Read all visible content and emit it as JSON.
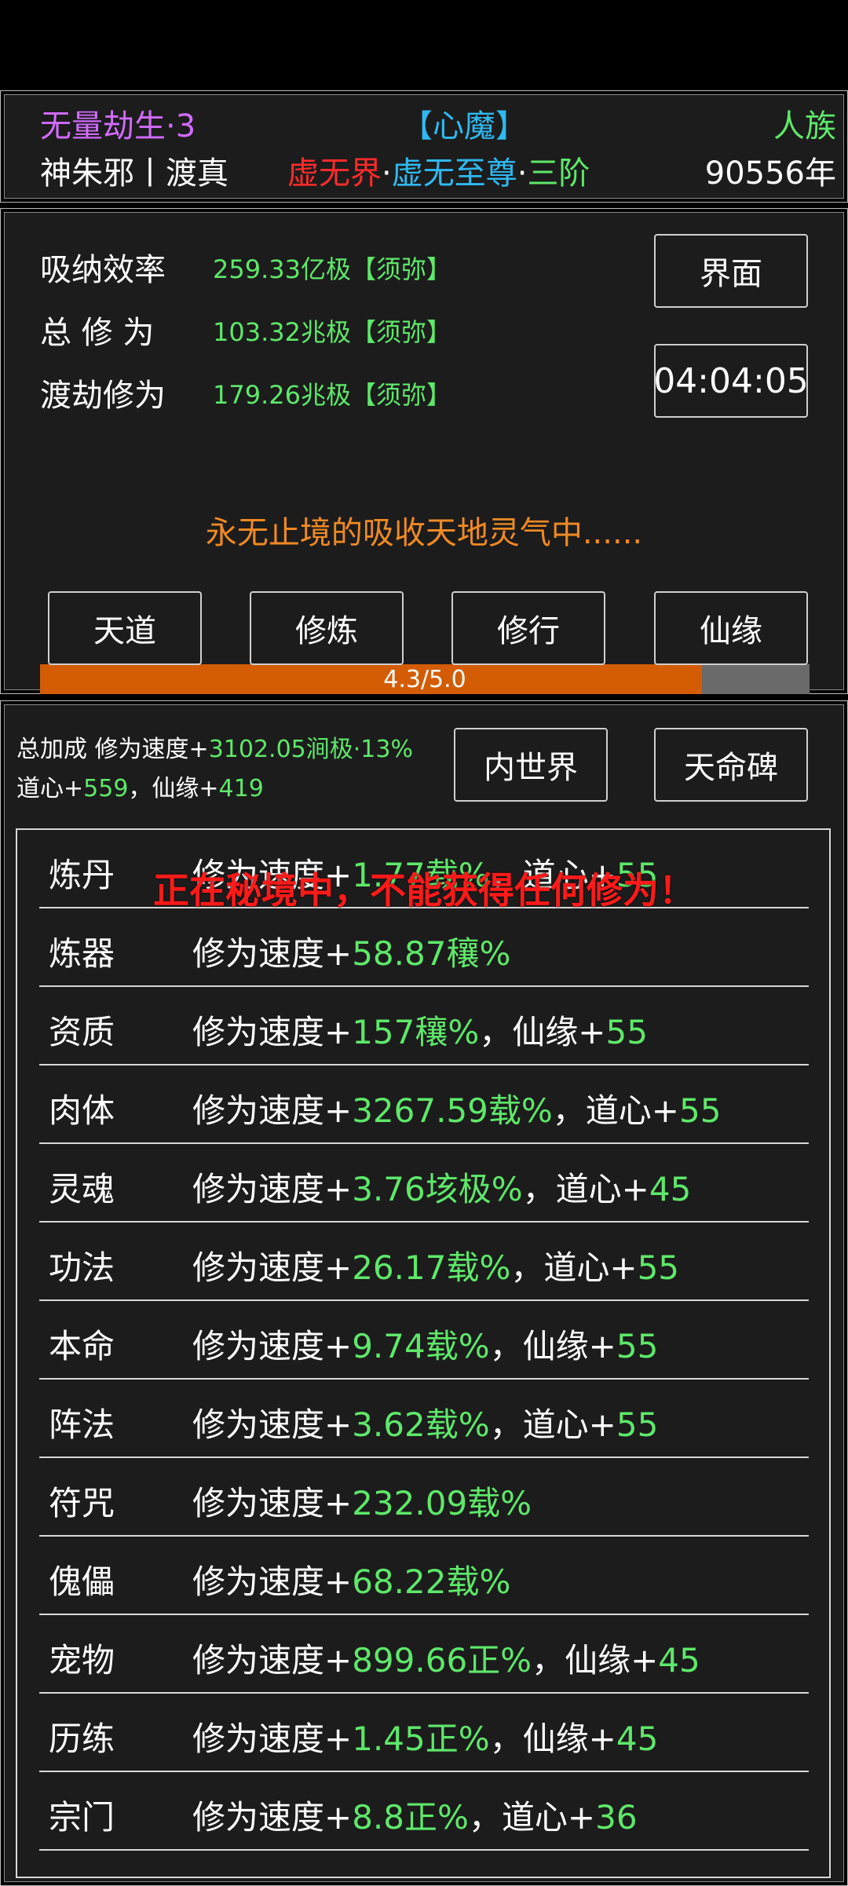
{
  "header": {
    "realm_title": "无量劫生·3",
    "status": "【心魔】",
    "race": "人族",
    "name": "神朱邪丨渡真",
    "world_a": "虚无界",
    "dot": "·",
    "world_b": "虚无至尊",
    "world_c": "三阶",
    "years": "90556年"
  },
  "stats": {
    "absorb_label": "吸纳效率",
    "absorb_value": "259.33亿极【须弥】",
    "total_label": "总 修 为",
    "total_value": "103.32兆极【须弥】",
    "tribulation_label": "渡劫修为",
    "tribulation_value": "179.26兆极【须弥】",
    "interface_button": "界面",
    "timer": "04:04:05",
    "progress_text": "4.3/5.0",
    "progress_fraction": 0.86,
    "absorbing_text": "永无止境的吸收天地灵气中......"
  },
  "actions": [
    "天道",
    "修炼",
    "修行",
    "仙缘"
  ],
  "bonus": {
    "line1_prefix": "总加成 修为速度+",
    "line1_value": "3102.05涧极·13%",
    "line2_a_label": "道心+",
    "line2_a_value": "559",
    "line2_sep": "，仙缘+",
    "line2_b_value": "419",
    "inner_world_button": "内世界",
    "fate_stele_button": "天命碑"
  },
  "warning": "正在秘境中，不能获得任何修为！",
  "rows": [
    {
      "name": "炼丹",
      "prefix": "修为速度+",
      "value": "1.77载%",
      "extra_label": "，道心+",
      "extra_value": "55"
    },
    {
      "name": "炼器",
      "prefix": "修为速度+",
      "value": "58.87穰%",
      "extra_label": "",
      "extra_value": ""
    },
    {
      "name": "资质",
      "prefix": "修为速度+",
      "value": "157穰%",
      "extra_label": "，仙缘+",
      "extra_value": "55"
    },
    {
      "name": "肉体",
      "prefix": "修为速度+",
      "value": "3267.59载%",
      "extra_label": "，道心+",
      "extra_value": "55"
    },
    {
      "name": "灵魂",
      "prefix": "修为速度+",
      "value": "3.76垓极%",
      "extra_label": "，道心+",
      "extra_value": "45"
    },
    {
      "name": "功法",
      "prefix": "修为速度+",
      "value": "26.17载%",
      "extra_label": "，道心+",
      "extra_value": "55"
    },
    {
      "name": "本命",
      "prefix": "修为速度+",
      "value": "9.74载%",
      "extra_label": "，仙缘+",
      "extra_value": "55"
    },
    {
      "name": "阵法",
      "prefix": "修为速度+",
      "value": "3.62载%",
      "extra_label": "，道心+",
      "extra_value": "55"
    },
    {
      "name": "符咒",
      "prefix": "修为速度+",
      "value": "232.09载%",
      "extra_label": "",
      "extra_value": ""
    },
    {
      "name": "傀儡",
      "prefix": "修为速度+",
      "value": "68.22载%",
      "extra_label": "",
      "extra_value": ""
    },
    {
      "name": "宠物",
      "prefix": "修为速度+",
      "value": "899.66正%",
      "extra_label": "，仙缘+",
      "extra_value": "45"
    },
    {
      "name": "历练",
      "prefix": "修为速度+",
      "value": "1.45正%",
      "extra_label": "，仙缘+",
      "extra_value": "45"
    },
    {
      "name": "宗门",
      "prefix": "修为速度+",
      "value": "8.8正%",
      "extra_label": "，道心+",
      "extra_value": "36"
    }
  ]
}
